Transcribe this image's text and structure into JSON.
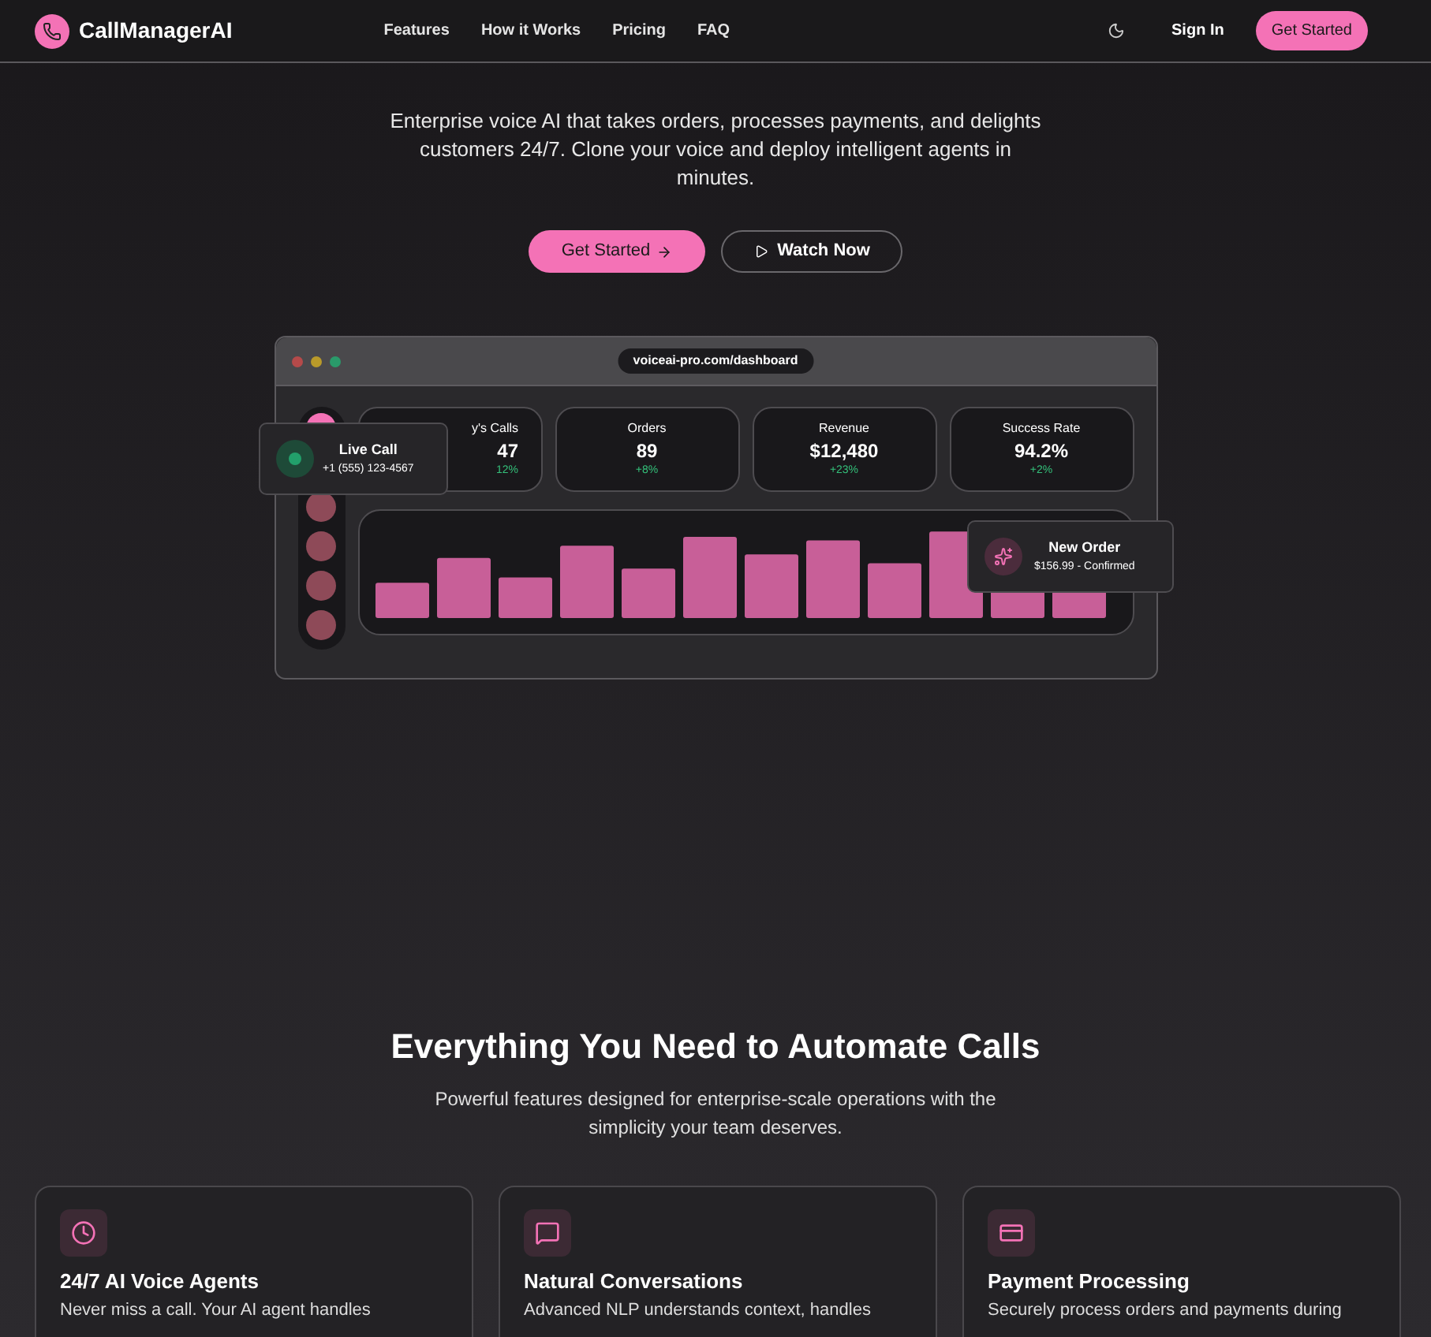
{
  "header": {
    "brand": "CallManagerAI",
    "nav": [
      "Features",
      "How it Works",
      "Pricing",
      "FAQ"
    ],
    "sign_in": "Sign In",
    "cta": "Get Started"
  },
  "hero": {
    "subtitle": "Enterprise voice AI that takes orders, processes payments, and delights customers 24/7. Clone your voice and deploy intelligent agents in minutes.",
    "primary": "Get Started",
    "secondary": "Watch Now"
  },
  "dashboard": {
    "url": "voiceai-pro.com/dashboard",
    "sidebar": [
      {
        "selected": true
      },
      {
        "selected": false
      },
      {
        "selected": false
      },
      {
        "selected": false
      },
      {
        "selected": false
      }
    ],
    "stats": [
      {
        "label": "y's Calls",
        "value": "47",
        "change": "12%",
        "partly_hidden": true
      },
      {
        "label": "Orders",
        "value": "89",
        "change": "+8%",
        "partly_hidden": false
      },
      {
        "label": "Revenue",
        "value": "$12,480",
        "change": "+23%",
        "partly_hidden": false
      },
      {
        "label": "Success Rate",
        "value": "94.2%",
        "change": "+2%",
        "partly_hidden": false
      }
    ],
    "live_call": {
      "title": "Live Call",
      "number": "+1 (555) 123-4567"
    },
    "new_order": {
      "title": "New Order",
      "detail": "$156.99 - Confirmed"
    }
  },
  "features": {
    "title": "Everything You Need to Automate Calls",
    "subtitle": "Powerful features designed for enterprise-scale operations with the simplicity your team deserves.",
    "cards": [
      {
        "kind": "clock",
        "title": "24/7 AI Voice Agents",
        "text": "Never miss a call. Your AI agent handles"
      },
      {
        "kind": "chat",
        "title": "Natural Conversations",
        "text": "Advanced NLP understands context, handles"
      },
      {
        "kind": "card",
        "title": "Payment Processing",
        "text": "Securely process orders and payments during"
      }
    ]
  }
}
